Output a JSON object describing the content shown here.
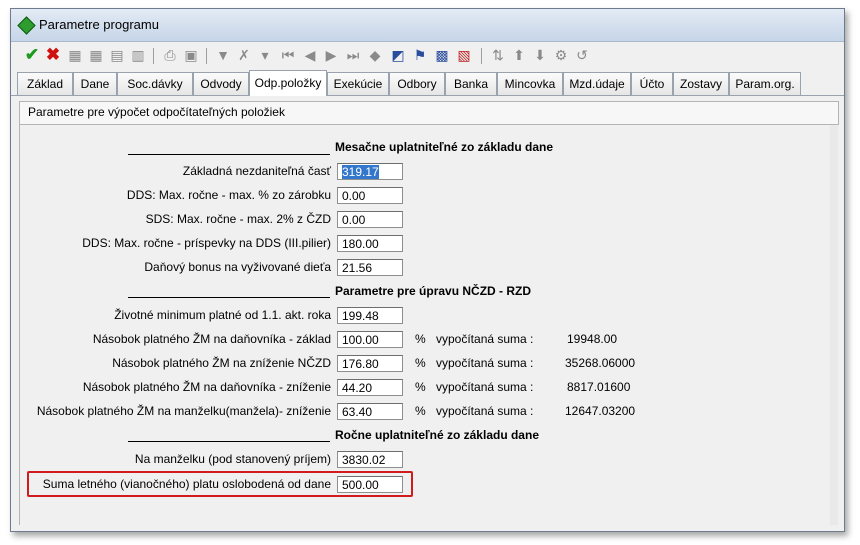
{
  "window": {
    "title": "Parametre programu"
  },
  "toolbar": {
    "icons": [
      "ok-check",
      "cancel-x",
      "grid-1",
      "grid-2",
      "grid-3",
      "grid-4",
      "printer",
      "doc",
      "filter",
      "filter-x",
      "filter-2",
      "first",
      "prev",
      "next",
      "last",
      "copy",
      "special",
      "flag",
      "grid-color",
      "grid-red",
      "sort",
      "up",
      "down",
      "gear",
      "refresh"
    ]
  },
  "tabs": [
    "Základ",
    "Dane",
    "Soc.dávky",
    "Odvody",
    "Odp.položky",
    "Exekúcie",
    "Odbory",
    "Banka",
    "Mincovka",
    "Mzd.údaje",
    "Účto",
    "Zostavy",
    "Param.org."
  ],
  "active_tab": "Odp.položky",
  "panel": {
    "header": "Parametre pre výpočet odpočítateľných položiek"
  },
  "sections": {
    "monthly": "Mesačne uplatniteľné zo základu dane",
    "nczd": "Parametre pre úpravu NČZD - RZD",
    "annual": "Ročne uplatniteľné zo základu dane"
  },
  "rows": {
    "r1": {
      "label": "Základná nezdaniteľná časť",
      "value": "319.17"
    },
    "r2": {
      "label": "DDS: Max. ročne - max. % zo zárobku",
      "value": "0.00"
    },
    "r3": {
      "label": "SDS: Max. ročne - max. 2% z ČZD",
      "value": "0.00"
    },
    "r4": {
      "label": "DDS: Max. ročne - príspevky na DDS (III.pilier)",
      "value": "180.00"
    },
    "r5": {
      "label": "Daňový bonus na vyživované dieťa",
      "value": "21.56"
    },
    "r6": {
      "label": "Životné minimum platné od 1.1. akt. roka",
      "value": "199.48"
    },
    "r7": {
      "label": "Násobok platného ŽM na daňovníka - základ",
      "value": "100.00",
      "pct": "%",
      "calc_label": "vypočítaná suma :",
      "calc": "19948.00"
    },
    "r8": {
      "label": "Násobok platného ŽM na zníženie NČZD",
      "value": "176.80",
      "pct": "%",
      "calc_label": "vypočítaná suma :",
      "calc": "35268.06000"
    },
    "r9": {
      "label": "Násobok platného ŽM na daňovníka - zníženie",
      "value": "44.20",
      "pct": "%",
      "calc_label": "vypočítaná suma :",
      "calc": "8817.01600"
    },
    "r10": {
      "label": "Násobok platného ŽM na manželku(manžela)- zníženie",
      "value": "63.40",
      "pct": "%",
      "calc_label": "vypočítaná suma :",
      "calc": "12647.03200"
    },
    "r11": {
      "label": "Na manželku (pod stanovený príjem)",
      "value": "3830.02"
    },
    "r12": {
      "label": "Suma letného (vianočného) platu oslobodená od dane",
      "value": "500.00"
    }
  }
}
